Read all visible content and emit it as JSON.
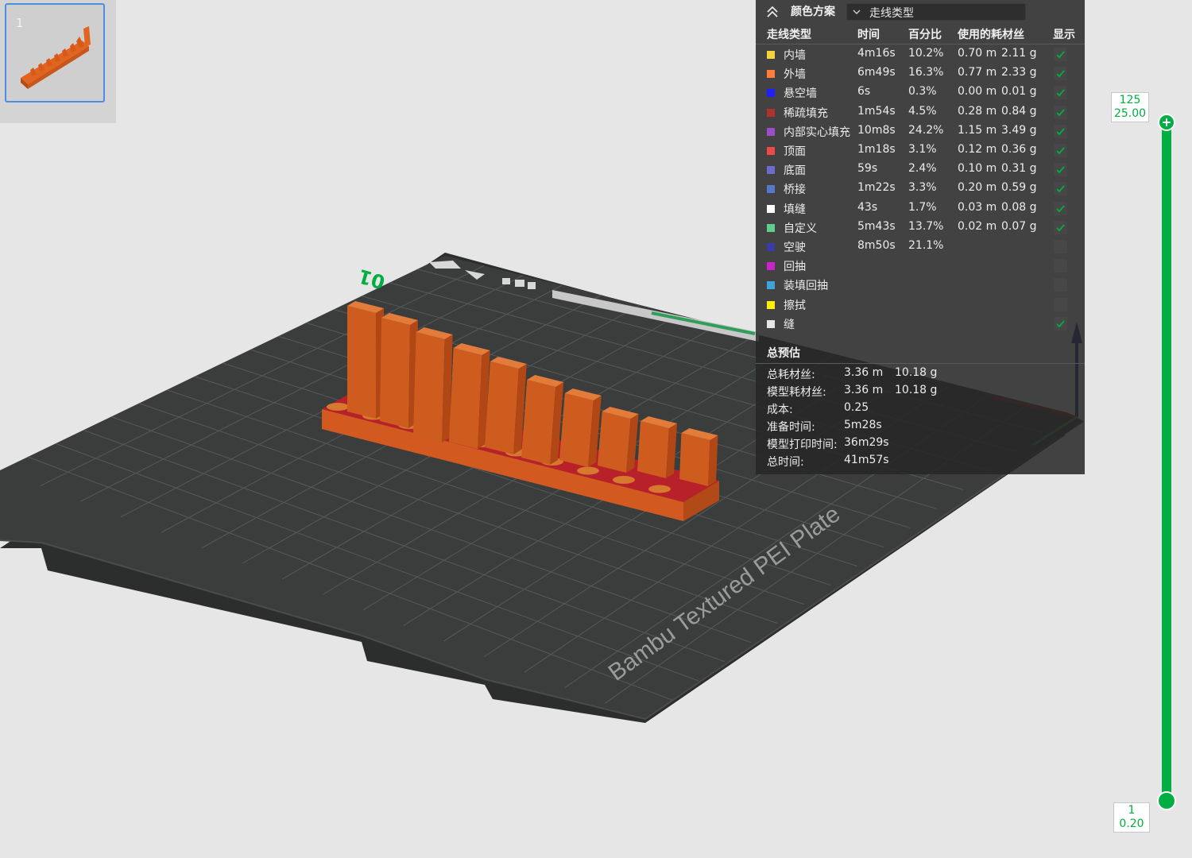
{
  "thumbnail": {
    "plate_index": "1"
  },
  "plate": {
    "name_label": "Bambu Textured PEI Plate",
    "number_label": "01"
  },
  "legend": {
    "scheme_title": "颜色方案",
    "scheme_value": "走线类型",
    "headers": {
      "type": "走线类型",
      "time": "时间",
      "percent": "百分比",
      "filament": "使用的耗材丝",
      "show": "显示"
    },
    "rows": [
      {
        "name": "内墙",
        "time": "4m16s",
        "percent": "10.2%",
        "length": "0.70 m",
        "weight": "2.11 g",
        "color": "#f5d33b",
        "shown": true
      },
      {
        "name": "外墙",
        "time": "6m49s",
        "percent": "16.3%",
        "length": "0.77 m",
        "weight": "2.33 g",
        "color": "#ff7d38",
        "shown": true
      },
      {
        "name": "悬空墙",
        "time": "6s",
        "percent": "0.3%",
        "length": "0.00 m",
        "weight": "0.01 g",
        "color": "#1f1fff",
        "shown": true
      },
      {
        "name": "稀疏填充",
        "time": "1m54s",
        "percent": "4.5%",
        "length": "0.28 m",
        "weight": "0.84 g",
        "color": "#b0322c",
        "shown": true
      },
      {
        "name": "内部实心填充",
        "time": "10m8s",
        "percent": "24.2%",
        "length": "1.15 m",
        "weight": "3.49 g",
        "color": "#9a4fc9",
        "shown": true
      },
      {
        "name": "顶面",
        "time": "1m18s",
        "percent": "3.1%",
        "length": "0.12 m",
        "weight": "0.36 g",
        "color": "#f04848",
        "shown": true
      },
      {
        "name": "底面",
        "time": "59s",
        "percent": "2.4%",
        "length": "0.10 m",
        "weight": "0.31 g",
        "color": "#6c6ccc",
        "shown": true
      },
      {
        "name": "桥接",
        "time": "1m22s",
        "percent": "3.3%",
        "length": "0.20 m",
        "weight": "0.59 g",
        "color": "#5577cc",
        "shown": true
      },
      {
        "name": "填缝",
        "time": "43s",
        "percent": "1.7%",
        "length": "0.03 m",
        "weight": "0.08 g",
        "color": "#ffffff",
        "shown": true
      },
      {
        "name": "自定义",
        "time": "5m43s",
        "percent": "13.7%",
        "length": "0.02 m",
        "weight": "0.07 g",
        "color": "#5ecf8e",
        "shown": true
      },
      {
        "name": "空驶",
        "time": "8m50s",
        "percent": "21.1%",
        "length": "",
        "weight": "",
        "color": "#3a3aa8",
        "shown": false
      },
      {
        "name": "回抽",
        "time": "",
        "percent": "",
        "length": "",
        "weight": "",
        "color": "#cc22cc",
        "shown": false
      },
      {
        "name": "装填回抽",
        "time": "",
        "percent": "",
        "length": "",
        "weight": "",
        "color": "#3ea3dc",
        "shown": false
      },
      {
        "name": "擦拭",
        "time": "",
        "percent": "",
        "length": "",
        "weight": "",
        "color": "#ffee00",
        "shown": false
      },
      {
        "name": "缝",
        "time": "",
        "percent": "",
        "length": "",
        "weight": "",
        "color": "#e6e6e6",
        "shown": true
      }
    ],
    "summary_title": "总预估",
    "summary": [
      {
        "label": "总耗材丝:",
        "v1": "3.36 m",
        "v2": "10.18 g"
      },
      {
        "label": "模型耗材丝:",
        "v1": "3.36 m",
        "v2": "10.18 g"
      },
      {
        "label": "成本:",
        "v1": "0.25",
        "v2": ""
      },
      {
        "label": "准备时间:",
        "v1": "5m28s",
        "v2": ""
      },
      {
        "label": "模型打印时间:",
        "v1": "36m29s",
        "v2": ""
      },
      {
        "label": "总时间:",
        "v1": "41m57s",
        "v2": ""
      }
    ]
  },
  "slider": {
    "top_layer": "125",
    "top_height": "25.00",
    "bottom_layer": "1",
    "bottom_height": "0.20"
  },
  "colors": {
    "accent": "#00ae42",
    "model": "#c8561c",
    "plate": "#3a3c3c"
  }
}
